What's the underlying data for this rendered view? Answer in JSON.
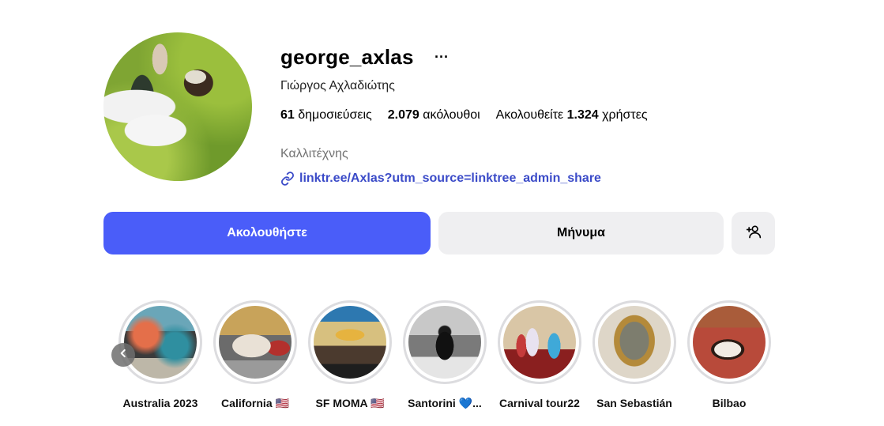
{
  "profile": {
    "username": "george_axlas",
    "more_icon_glyph": "···",
    "full_name": "Γιώργος Αχλαδιώτης",
    "category": "Καλλιτέχνης",
    "link_text": "linktr.ee/Axlas?utm_source=linktree_admin_share",
    "avatar_icon": "profile-photo"
  },
  "stats": {
    "posts_count": "61",
    "posts_label": "δημοσιεύσεις",
    "followers_count": "2.079",
    "followers_label": "ακόλουθοι",
    "following_prefix": "Ακολουθείτε",
    "following_count": "1.324",
    "following_suffix": "χρήστες"
  },
  "actions": {
    "follow_label": "Ακολουθήστε",
    "message_label": "Μήνυμα",
    "add_user_icon": "person-plus-icon"
  },
  "highlights": [
    {
      "label": "Australia 2023"
    },
    {
      "label": "California 🇺🇸"
    },
    {
      "label": "SF MOMA 🇺🇸"
    },
    {
      "label": "Santorini 💙..."
    },
    {
      "label": "Carnival tour22"
    },
    {
      "label": "San Sebastián"
    },
    {
      "label": "Bilbao"
    }
  ],
  "colors": {
    "accent": "#4a5df9",
    "link": "#3b4bc8",
    "secondary_button": "#efeff1",
    "muted_text": "#737373"
  }
}
